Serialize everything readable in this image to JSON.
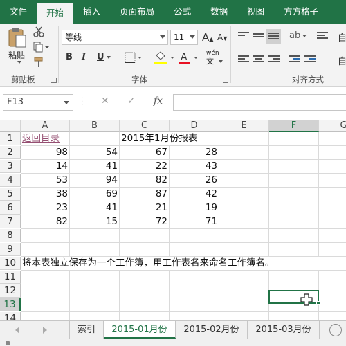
{
  "ribbon_tabs": [
    "文件",
    "开始",
    "插入",
    "页面布局",
    "公式",
    "数据",
    "视图",
    "方方格子"
  ],
  "active_tab": "开始",
  "ribbon": {
    "clipboard": {
      "paste_label": "粘贴",
      "group_label": "剪贴板"
    },
    "font": {
      "font_name": "等线",
      "font_size": "11",
      "bold": "B",
      "italic": "I",
      "underline": "U",
      "grow": "A",
      "shrink": "A",
      "wen": "wén",
      "group_label": "字体"
    },
    "alignment": {
      "group_label": "对齐方式"
    },
    "partial_label": "自"
  },
  "formula_bar": {
    "name_box": "F13",
    "fx_label": "fx",
    "content": ""
  },
  "columns": [
    "A",
    "B",
    "C",
    "D",
    "E",
    "F",
    "G"
  ],
  "selected_column": "F",
  "rows": [
    "1",
    "2",
    "3",
    "4",
    "5",
    "6",
    "7",
    "8",
    "9",
    "10",
    "11",
    "12",
    "13",
    "14"
  ],
  "selected_row": "13",
  "cells": {
    "A1": "返回目录",
    "C1": "2015年1月份报表",
    "data": [
      [
        "98",
        "54",
        "67",
        "28"
      ],
      [
        "14",
        "41",
        "22",
        "43"
      ],
      [
        "53",
        "94",
        "82",
        "26"
      ],
      [
        "38",
        "69",
        "87",
        "42"
      ],
      [
        "23",
        "41",
        "21",
        "19"
      ],
      [
        "82",
        "15",
        "72",
        "71"
      ]
    ],
    "A10": "将本表独立保存为一个工作簿，用工作表名来命名工作簿名。"
  },
  "sheet_tabs": [
    "索引",
    "2015-01月份",
    "2015-02月份",
    "2015-03月份"
  ],
  "active_sheet": "2015-01月份",
  "colors": {
    "accent": "#217346",
    "link": "#954f72",
    "font_color": "#e81123",
    "highlight": "#ffff00"
  }
}
